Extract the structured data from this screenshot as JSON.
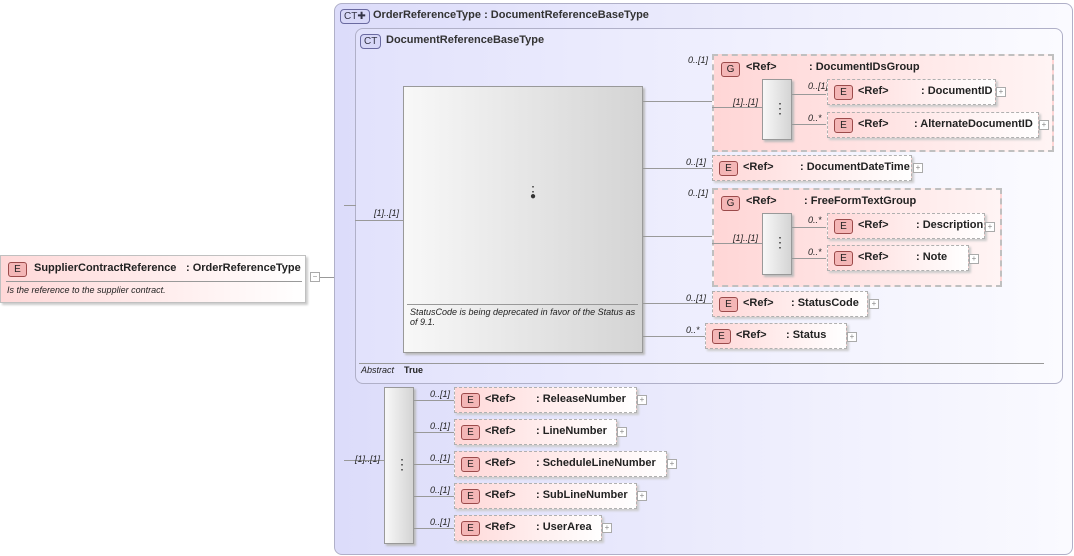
{
  "root": {
    "badge": "E",
    "name": "SupplierContractReference",
    "type": ": OrderReferenceType",
    "doc": "Is the reference to the supplier contract.",
    "collapse": "−"
  },
  "outer": {
    "badge": "CT✚",
    "title": "OrderReferenceType : DocumentReferenceBaseType"
  },
  "inner": {
    "badge": "CT",
    "title": "DocumentReferenceBaseType",
    "annotation": "StatusCode is being deprecated in favor of the Status as of 9.1.",
    "abstract_label": "Abstract",
    "abstract_value": "True",
    "seq_card": "[1]..[1]"
  },
  "ref": "<Ref>",
  "group1": {
    "badge": "G",
    "name": ": DocumentIDsGroup",
    "card": "0..[1]",
    "seq_card": "[1]..[1]",
    "items": [
      {
        "badge": "E",
        "name": ": DocumentID",
        "card": "0..[1]"
      },
      {
        "badge": "E",
        "name": ": AlternateDocumentID",
        "card": "0..*"
      }
    ]
  },
  "docdatetime": {
    "badge": "E",
    "name": ": DocumentDateTime",
    "card": "0..[1]"
  },
  "group2": {
    "badge": "G",
    "name": ": FreeFormTextGroup",
    "card": "0..[1]",
    "seq_card": "[1]..[1]",
    "items": [
      {
        "badge": "E",
        "name": ": Description",
        "card": "0..*"
      },
      {
        "badge": "E",
        "name": ": Note",
        "card": "0..*"
      }
    ]
  },
  "statuscode": {
    "badge": "E",
    "name": ": StatusCode",
    "card": "0..[1]"
  },
  "status": {
    "badge": "E",
    "name": ": Status",
    "card": "0..*"
  },
  "lower": {
    "seq_card": "[1]..[1]",
    "items": [
      {
        "badge": "E",
        "name": ": ReleaseNumber",
        "card": "0..[1]"
      },
      {
        "badge": "E",
        "name": ": LineNumber",
        "card": "0..[1]"
      },
      {
        "badge": "E",
        "name": ": ScheduleLineNumber",
        "card": "0..[1]"
      },
      {
        "badge": "E",
        "name": ": SubLineNumber",
        "card": "0..[1]"
      },
      {
        "badge": "E",
        "name": ": UserArea",
        "card": "0..[1]"
      }
    ]
  },
  "plus": "+",
  "seq_icon": "⋮"
}
